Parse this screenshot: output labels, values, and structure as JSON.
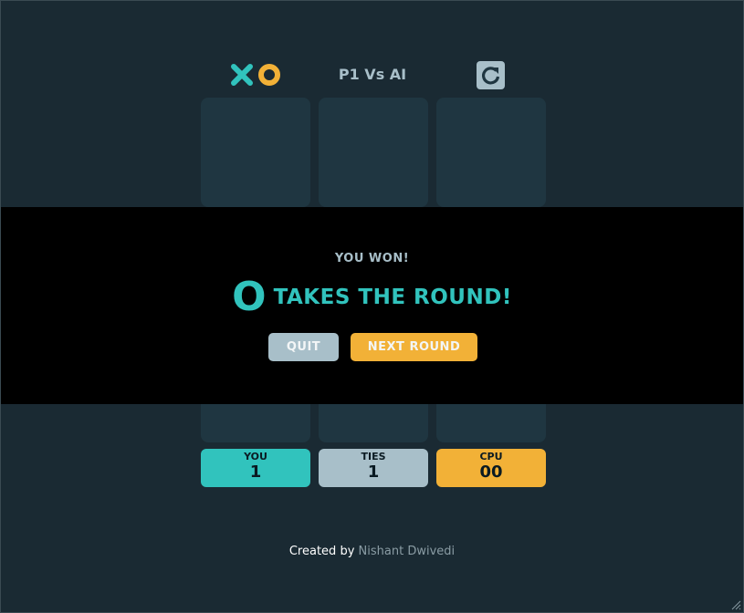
{
  "header": {
    "title": "P1 Vs AI",
    "logo_x_icon": "x-mark",
    "logo_o_icon": "o-mark",
    "restart_icon": "restart-icon"
  },
  "board": {
    "cells": [
      "",
      "",
      "",
      "",
      "",
      "",
      "",
      "",
      ""
    ]
  },
  "scores": {
    "you": {
      "label": "YOU",
      "value": "1",
      "color": "#31c3bd"
    },
    "ties": {
      "label": "TIES",
      "value": "1",
      "color": "#a8bfc9"
    },
    "cpu": {
      "label": "CPU",
      "value": "00",
      "color": "#f2b137"
    }
  },
  "modal": {
    "subtitle": "YOU WON!",
    "mark": "O",
    "message": "TAKES THE ROUND!",
    "quit_label": "QUIT",
    "next_label": "NEXT ROUND"
  },
  "footer": {
    "prefix": "Created by",
    "author": "Nishant Dwivedi"
  },
  "colors": {
    "background": "#1a2a33",
    "cell": "#1f3641",
    "teal": "#31c3bd",
    "yellow": "#f2b137",
    "silver": "#a8bfc9"
  }
}
